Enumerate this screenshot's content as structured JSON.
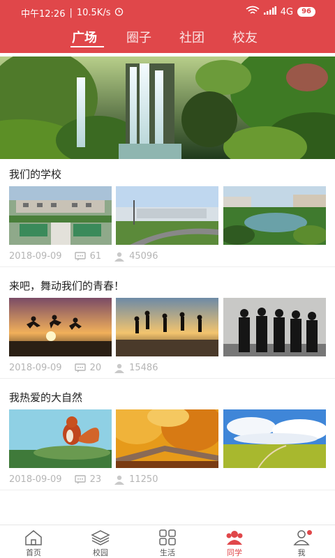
{
  "status_bar": {
    "time": "中午12:26",
    "speed": "10.5K/s",
    "network": "4G",
    "battery": "96"
  },
  "tabs": [
    {
      "label": "广场",
      "active": true
    },
    {
      "label": "圈子",
      "active": false
    },
    {
      "label": "社团",
      "active": false
    },
    {
      "label": "校友",
      "active": false
    }
  ],
  "posts": [
    {
      "title": "我们的学校",
      "date": "2018-09-09",
      "comments": "61",
      "views": "45096"
    },
    {
      "title": "来吧，舞动我们的青春！",
      "date": "2018-09-09",
      "comments": "20",
      "views": "15486"
    },
    {
      "title": "我热爱的大自然",
      "date": "2018-09-09",
      "comments": "23",
      "views": "11250"
    }
  ],
  "navbar": [
    {
      "label": "首页",
      "icon": "home-icon"
    },
    {
      "label": "校园",
      "icon": "layers-icon"
    },
    {
      "label": "生活",
      "icon": "grid-icon"
    },
    {
      "label": "同学",
      "icon": "classmates-icon",
      "active": true
    },
    {
      "label": "我",
      "icon": "profile-icon",
      "badge": true
    }
  ],
  "colors": {
    "accent": "#e0474a",
    "meta": "#b5b5b5"
  }
}
